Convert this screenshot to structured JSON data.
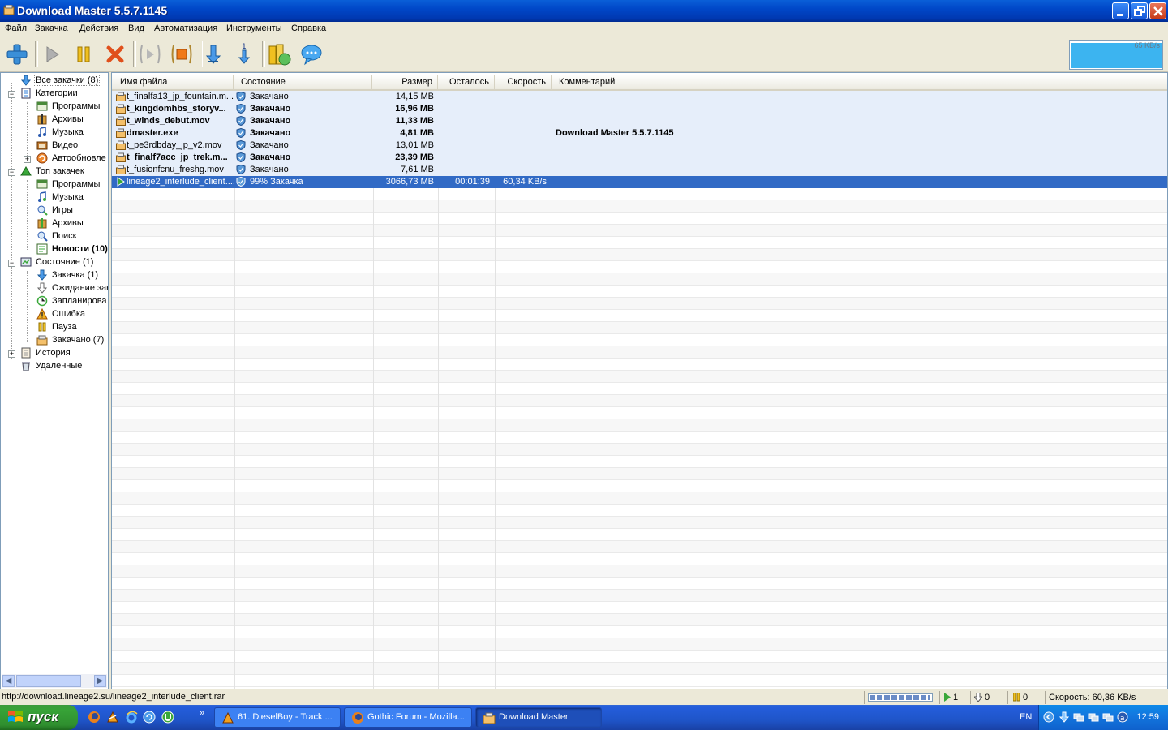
{
  "window": {
    "title": "Download Master 5.5.7.1145",
    "icon": "download-master-icon"
  },
  "menu": [
    "Файл",
    "Закачка",
    "Действия",
    "Вид",
    "Автоматизация",
    "Инструменты",
    "Справка"
  ],
  "toolbar": {
    "buttons": [
      "add-icon",
      "start-icon",
      "pause-icon",
      "delete-icon",
      "start-all-icon",
      "stop-all-icon",
      "download-down-icon",
      "download-one-icon",
      "scheduler-icon",
      "chat-icon"
    ],
    "speed_graph_label": "65 KB/s"
  },
  "tree": {
    "all": "Все закачки (8)",
    "categories": "Категории",
    "cat_programs": "Программы",
    "cat_archives": "Архивы",
    "cat_music": "Музыка",
    "cat_video": "Видео",
    "cat_autoupdate": "Автообновле",
    "top": "Топ закачек",
    "top_programs": "Программы",
    "top_music": "Музыка",
    "top_games": "Игры",
    "top_archives": "Архивы",
    "top_search": "Поиск",
    "top_news": "Новости (10)",
    "status": "Состояние (1)",
    "st_downloading": "Закачка (1)",
    "st_waiting": "Ожидание зак",
    "st_scheduled": "Запланирова",
    "st_error": "Ошибка",
    "st_paused": "Пауза",
    "st_completed": "Закачано (7)",
    "history": "История",
    "deleted": "Удаленные"
  },
  "columns": {
    "name": "Имя файла",
    "state": "Состояние",
    "size": "Размер",
    "remaining": "Осталось",
    "speed": "Скорость",
    "comment": "Комментарий"
  },
  "rows": [
    {
      "name": "t_finalfa13_jp_fountain.m...",
      "state": "Закачано",
      "size": "14,15 MB",
      "remaining": "",
      "speed": "",
      "comment": ""
    },
    {
      "name": "t_kingdomhbs_storyv...",
      "state": "Закачано",
      "size": "16,96 MB",
      "remaining": "",
      "speed": "",
      "comment": ""
    },
    {
      "name": "t_winds_debut.mov",
      "state": "Закачано",
      "size": "11,33 MB",
      "remaining": "",
      "speed": "",
      "comment": ""
    },
    {
      "name": "dmaster.exe",
      "state": "Закачано",
      "size": "4,81 MB",
      "remaining": "",
      "speed": "",
      "comment": "Download Master 5.5.7.1145"
    },
    {
      "name": "t_pe3rdbday_jp_v2.mov",
      "state": "Закачано",
      "size": "13,01 MB",
      "remaining": "",
      "speed": "",
      "comment": ""
    },
    {
      "name": "t_finalf7acc_jp_trek.m...",
      "state": "Закачано",
      "size": "23,39 MB",
      "remaining": "",
      "speed": "",
      "comment": ""
    },
    {
      "name": "t_fusionfcnu_freshg.mov",
      "state": "Закачано",
      "size": "7,61 MB",
      "remaining": "",
      "speed": "",
      "comment": ""
    },
    {
      "name": "lineage2_interlude_client....",
      "state": "99% Закачка",
      "size": "3066,73 MB",
      "remaining": "00:01:39",
      "speed": "60,34 KB/s",
      "comment": ""
    }
  ],
  "statusbar": {
    "url": "http://download.lineage2.su/lineage2_interlude_client.rar",
    "progress_fraction": 0.99,
    "active_count": "1",
    "waiting_count": "0",
    "paused_count": "0",
    "speed": "Скорость: 60,36 KB/s"
  },
  "taskbar": {
    "start_label": "пуск",
    "tasks": [
      "61. DieselBoy - Track ...",
      "Gothic Forum - Mozilla...",
      "Download Master"
    ],
    "lang": "EN",
    "clock": "12:59"
  },
  "colors": {
    "selection": "#316ac5",
    "title_blue": "#0047c8",
    "start_green": "#37a337"
  }
}
